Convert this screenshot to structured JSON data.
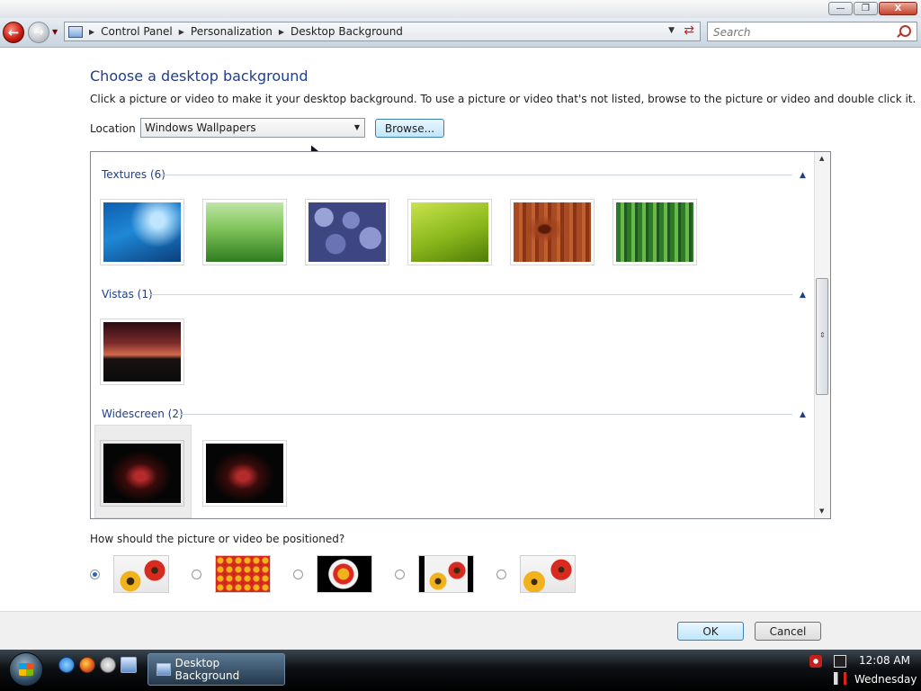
{
  "window": {
    "minimize_label": "—",
    "maximize_label": "❐",
    "close_label": "X"
  },
  "nav": {
    "back_glyph": "←",
    "forward_glyph": "→",
    "breadcrumbs": [
      "Control Panel",
      "Personalization",
      "Desktop Background"
    ],
    "search_placeholder": "Search"
  },
  "content": {
    "heading": "Choose a desktop background",
    "instructions": "Click a picture or video to make it your desktop background. To use a picture or video that's not listed, browse to the picture or video and double click it.",
    "location_label": "Location",
    "location_value": "Windows Wallpapers",
    "browse_label": "Browse..."
  },
  "gallery": {
    "groups": [
      {
        "title": "Textures (6)",
        "thumbs": [
          "fish-underwater",
          "green-grass",
          "blue-pebbles",
          "green-leaf",
          "wood-grain",
          "bamboo-forest"
        ]
      },
      {
        "title": "Vistas (1)",
        "thumbs": [
          "sunset-mountain"
        ]
      },
      {
        "title": "Widescreen (2)",
        "thumbs": [
          "dark-red-abstract",
          "dark-red-abstract-2"
        ],
        "selected_index": 0
      }
    ]
  },
  "position": {
    "question": "How should the picture or video be positioned?",
    "options": [
      "fit-to-screen",
      "tile",
      "center",
      "center-black",
      "stretch"
    ],
    "selected_index": 0
  },
  "footer": {
    "ok_label": "OK",
    "cancel_label": "Cancel"
  },
  "taskbar": {
    "task_label": "Desktop Background",
    "time": "12:08 AM",
    "day": "Wednesday"
  },
  "colors": {
    "heading": "#1f3f8a",
    "group": "#1f3f8a",
    "accent_button": "#bee6fd"
  }
}
